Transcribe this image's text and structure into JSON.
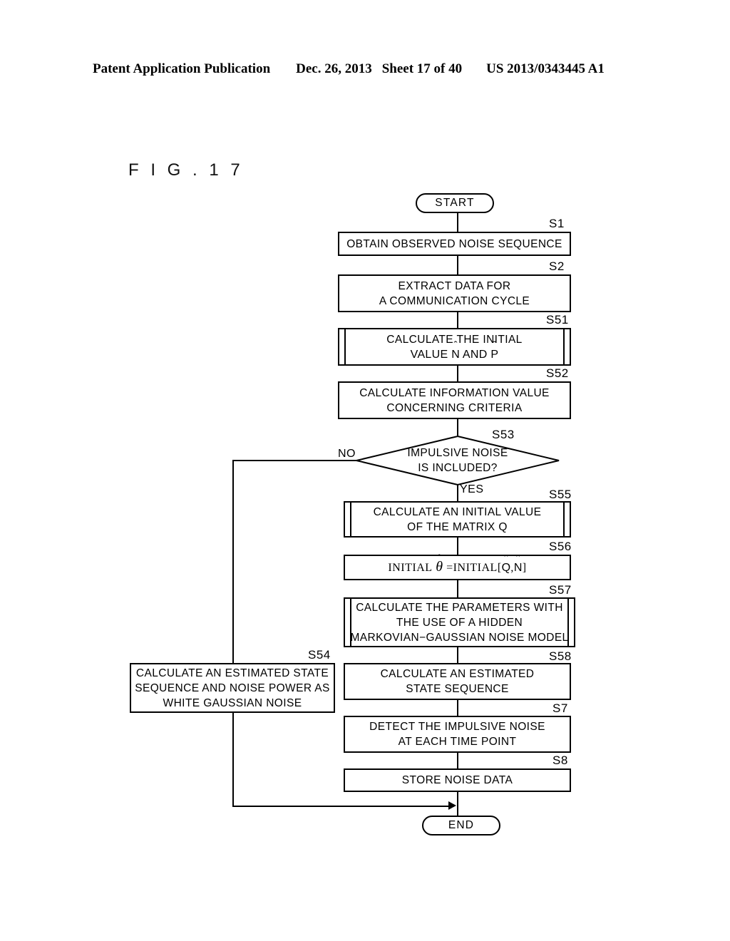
{
  "header": {
    "publication": "Patent Application Publication",
    "date": "Dec. 26, 2013",
    "sheet": "Sheet 17 of 40",
    "pubnumber": "US 2013/0343445 A1"
  },
  "figure": {
    "label": "F I G .  1 7"
  },
  "flowchart": {
    "start_label": "START",
    "end_label": "END",
    "branch_yes": "YES",
    "branch_no": "NO",
    "steps": [
      {
        "id": "S1",
        "tag": "S1",
        "shape": "process",
        "lines": [
          "OBTAIN OBSERVED NOISE SEQUENCE"
        ]
      },
      {
        "id": "S2",
        "tag": "S2",
        "shape": "process",
        "lines": [
          "EXTRACT DATA FOR",
          "A COMMUNICATION CYCLE"
        ]
      },
      {
        "id": "S51",
        "tag": "S51",
        "shape": "predefined-process",
        "lines": [
          "CALCULATE THE INITIAL",
          "VALUE N̂ AND P̂"
        ]
      },
      {
        "id": "S52",
        "tag": "S52",
        "shape": "process",
        "lines": [
          "CALCULATE INFORMATION VALUE",
          "CONCERNING CRITERIA"
        ]
      },
      {
        "id": "S53",
        "tag": "S53",
        "shape": "decision",
        "lines": [
          "IMPULSIVE NOISE",
          "IS INCLUDED?"
        ]
      },
      {
        "id": "S55",
        "tag": "S55",
        "shape": "predefined-process",
        "lines": [
          "CALCULATE AN INITIAL VALUE",
          "OF THE MATRIX Q"
        ]
      },
      {
        "id": "S56",
        "tag": "S56",
        "shape": "process",
        "lines": [
          "INITIAL θ̂ = INITIAL[Q̂,N̂]"
        ]
      },
      {
        "id": "S57",
        "tag": "S57",
        "shape": "predefined-process",
        "lines": [
          "CALCULATE THE PARAMETERS WITH",
          "THE USE OF A HIDDEN",
          "MARKOVIAN−GAUSSIAN NOISE MODEL"
        ]
      },
      {
        "id": "S54",
        "tag": "S54",
        "shape": "process",
        "lines": [
          "CALCULATE AN ESTIMATED STATE",
          "SEQUENCE AND NOISE POWER AS",
          "WHITE GAUSSIAN NOISE"
        ]
      },
      {
        "id": "S58",
        "tag": "S58",
        "shape": "process",
        "lines": [
          "CALCULATE AN ESTIMATED",
          "STATE SEQUENCE"
        ]
      },
      {
        "id": "S7",
        "tag": "S7",
        "shape": "process",
        "lines": [
          "DETECT THE IMPULSIVE NOISE",
          "AT EACH TIME POINT"
        ]
      },
      {
        "id": "S8",
        "tag": "S8",
        "shape": "process",
        "lines": [
          "STORE NOISE DATA"
        ]
      }
    ]
  }
}
